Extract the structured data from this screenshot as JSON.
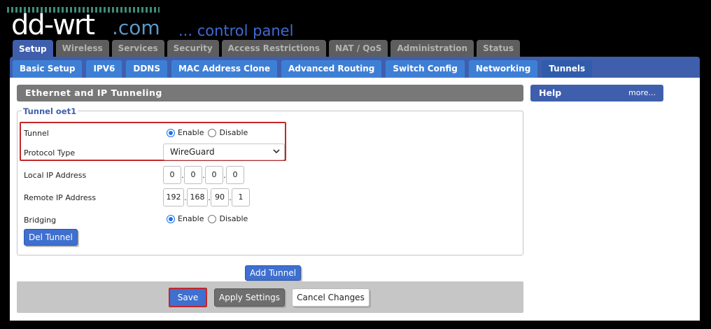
{
  "logo": {
    "brand": "dd-wrt",
    "domain": ".com",
    "subtitle": "... control panel"
  },
  "main_tabs": [
    {
      "label": "Setup",
      "active": true
    },
    {
      "label": "Wireless"
    },
    {
      "label": "Services"
    },
    {
      "label": "Security"
    },
    {
      "label": "Access Restrictions"
    },
    {
      "label": "NAT / QoS"
    },
    {
      "label": "Administration"
    },
    {
      "label": "Status"
    }
  ],
  "sub_tabs": [
    {
      "label": "Basic Setup"
    },
    {
      "label": "IPV6"
    },
    {
      "label": "DDNS"
    },
    {
      "label": "MAC Address Clone"
    },
    {
      "label": "Advanced Routing"
    },
    {
      "label": "Switch Config"
    },
    {
      "label": "Networking"
    },
    {
      "label": "Tunnels",
      "active": true
    }
  ],
  "section": {
    "title": "Ethernet and IP Tunneling"
  },
  "help": {
    "title": "Help",
    "more": "more..."
  },
  "tunnel": {
    "legend": "Tunnel oet1",
    "tunnel_label": "Tunnel",
    "enable_label": "Enable",
    "disable_label": "Disable",
    "tunnel_state": "Enable",
    "protocol_label": "Protocol Type",
    "protocol_value": "WireGuard",
    "local_ip_label": "Local IP Address",
    "local_ip": [
      "0",
      "0",
      "0",
      "0"
    ],
    "remote_ip_label": "Remote IP Address",
    "remote_ip": [
      "192",
      "168",
      "90",
      "1"
    ],
    "bridging_label": "Bridging",
    "bridging_state": "Enable",
    "del_button": "Del Tunnel"
  },
  "add_tunnel_button": "Add Tunnel",
  "actions": {
    "save": "Save",
    "apply": "Apply Settings",
    "cancel": "Cancel Changes"
  },
  "colors": {
    "accent_blue": "#3f5fad",
    "tab_blue": "#3e7fd6",
    "highlight_red": "#c0282a"
  }
}
